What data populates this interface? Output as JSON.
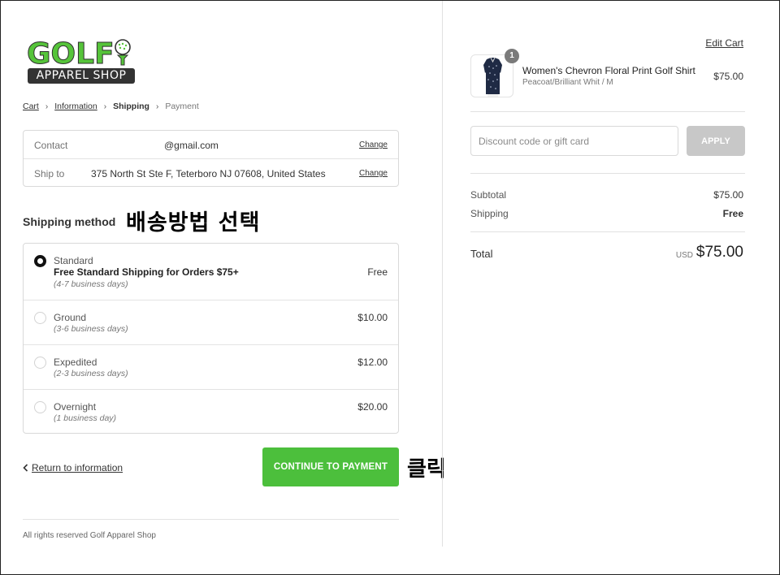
{
  "logo": {
    "word": "GOLF",
    "tagline": "APPAREL SHOP"
  },
  "breadcrumb": {
    "items": [
      "Cart",
      "Information",
      "Shipping",
      "Payment"
    ],
    "separator": "›"
  },
  "contact": {
    "label": "Contact",
    "value": "@gmail.com",
    "change": "Change"
  },
  "ship_to": {
    "label": "Ship to",
    "value": "375 North St Ste F, Teterboro NJ 07608, United States",
    "change": "Change"
  },
  "shipping_method": {
    "heading": "Shipping method",
    "annotation": "배송방법  선택",
    "selected": "Standard",
    "options": [
      {
        "name": "Standard",
        "description": "Free Standard Shipping for Orders $75+",
        "days": "(4-7 business days)",
        "price": "Free"
      },
      {
        "name": "Ground",
        "days": "(3-6 business days)",
        "price": "$10.00"
      },
      {
        "name": "Expedited",
        "days": "(2-3 business days)",
        "price": "$12.00"
      },
      {
        "name": "Overnight",
        "days": "(1 business day)",
        "price": "$20.00"
      }
    ]
  },
  "nav": {
    "return_label": "Return to information",
    "continue_label": "CONTINUE TO PAYMENT",
    "continue_annotation": "클릭"
  },
  "footer": {
    "text": "All rights reserved Golf Apparel Shop"
  },
  "cart": {
    "edit_label": "Edit Cart",
    "product": {
      "quantity": "1",
      "name": "Women's Chevron Floral Print Golf Shirt",
      "variant": "Peacoat/Brilliant Whit / M",
      "price": "$75.00"
    },
    "discount": {
      "placeholder": "Discount code or gift card",
      "apply_label": "APPLY"
    },
    "subtotal": {
      "label": "Subtotal",
      "value": "$75.00"
    },
    "shipping": {
      "label": "Shipping",
      "value": "Free"
    },
    "total": {
      "label": "Total",
      "currency": "USD",
      "value": "$75.00"
    }
  },
  "colors": {
    "accent_green": "#4cbf3c",
    "logo_green": "#56c43a",
    "apply_disabled": "#c8c8c8"
  }
}
